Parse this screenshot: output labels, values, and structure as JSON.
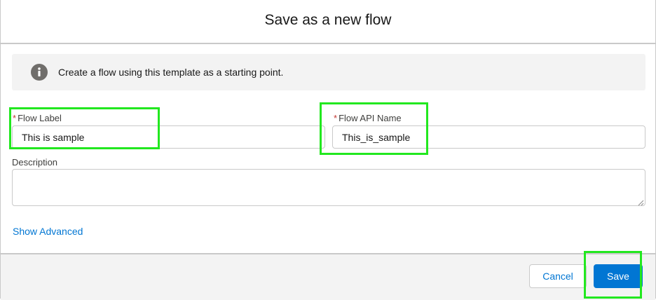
{
  "dialog": {
    "title": "Save as a new flow",
    "info_icon": "info-icon",
    "info_text": "Create a flow using this template as a starting point."
  },
  "form": {
    "required_marker": "*",
    "flow_label": {
      "label": "Flow Label",
      "value": "This is sample"
    },
    "flow_api_name": {
      "label": "Flow API Name",
      "value": "This_is_sample"
    },
    "description": {
      "label": "Description",
      "value": ""
    },
    "show_advanced_label": "Show Advanced"
  },
  "footer": {
    "cancel_label": "Cancel",
    "save_label": "Save"
  },
  "colors": {
    "brand": "#0176d3",
    "required": "#c23934",
    "highlight": "#22e81f"
  }
}
